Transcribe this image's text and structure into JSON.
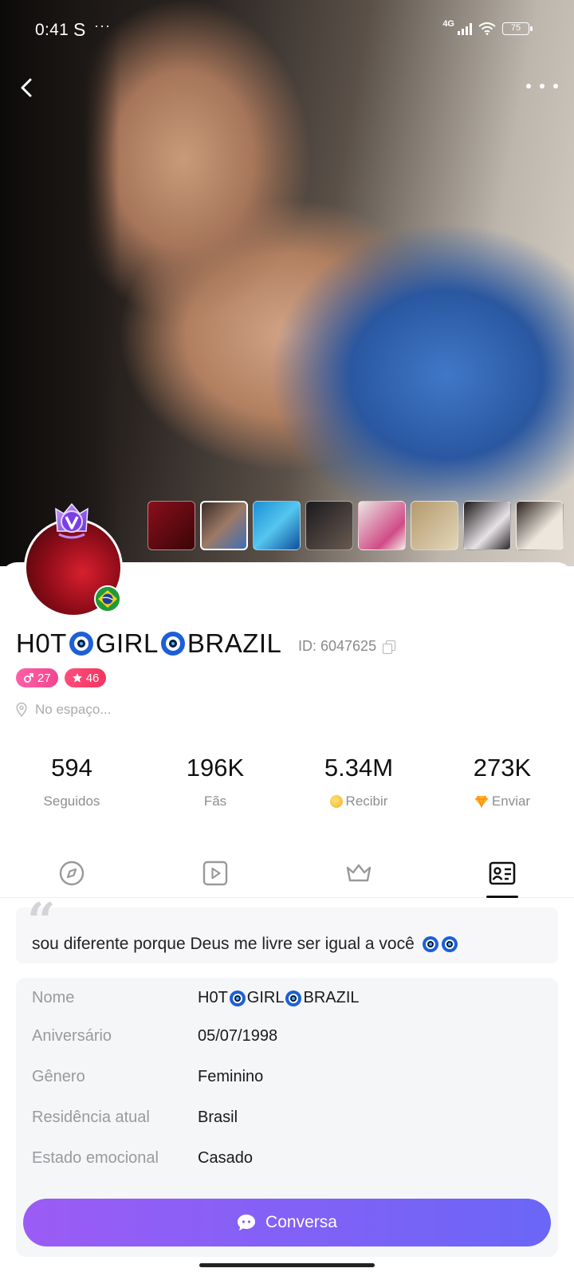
{
  "status_bar": {
    "time": "0:41",
    "carrier_glyph": "S",
    "extra": "···",
    "network": "4G",
    "battery": "75"
  },
  "profile": {
    "name_parts": [
      "H0T",
      "GIRL",
      "BRAZIL"
    ],
    "id_text": "ID: 6047625",
    "badges": [
      {
        "icon": "gender-icon",
        "value": "27",
        "color": "#f2478f"
      },
      {
        "icon": "star-icon",
        "value": "46",
        "color": "#f2365f"
      }
    ],
    "location": "No espaço...",
    "flag": "brazil-flag"
  },
  "stats": [
    {
      "value": "594",
      "label": "Seguidos"
    },
    {
      "value": "196K",
      "label": "Fãs"
    },
    {
      "value": "5.34M",
      "label": "Recibir",
      "icon": "coin-icon"
    },
    {
      "value": "273K",
      "label": "Enviar",
      "icon": "gem-icon"
    }
  ],
  "tabs": [
    {
      "icon": "compass-icon",
      "active": false
    },
    {
      "icon": "video-icon",
      "active": false
    },
    {
      "icon": "crown-icon",
      "active": false
    },
    {
      "icon": "profile-card-icon",
      "active": true
    }
  ],
  "bio": {
    "text": "sou diferente porque Deus me livre ser igual a você"
  },
  "info": [
    {
      "key": "Nome",
      "value_parts": [
        "H0T",
        "GIRL",
        "BRAZIL"
      ]
    },
    {
      "key": "Aniversário",
      "value": "05/07/1998"
    },
    {
      "key": "Gênero",
      "value": "Feminino"
    },
    {
      "key": "Residência atual",
      "value": "Brasil"
    },
    {
      "key": "Estado emocional",
      "value": "Casado"
    }
  ],
  "chat_button": {
    "label": "Conversa"
  },
  "colors": {
    "accent_start": "#9b5cf5",
    "accent_end": "#6a66f7",
    "evil_eye_blue": "#1d5fd8"
  }
}
